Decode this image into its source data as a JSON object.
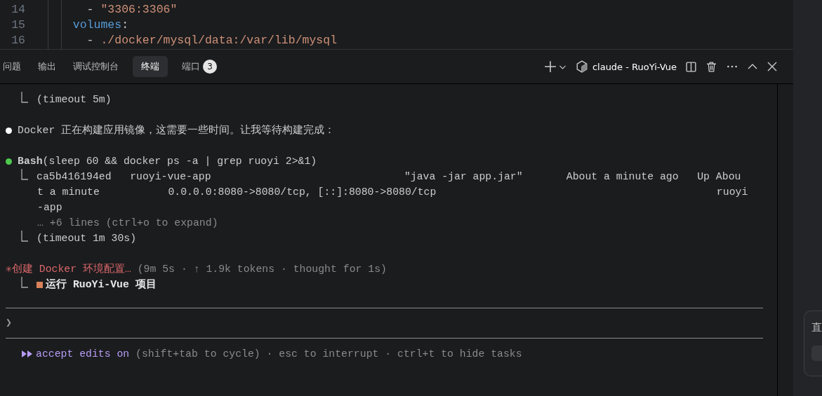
{
  "editor": {
    "lines": [
      {
        "number": "14",
        "segments": [
          {
            "kind": "punct",
            "text": "    - "
          },
          {
            "kind": "string",
            "text": "\"3306:3306\""
          }
        ]
      },
      {
        "number": "15",
        "segments": [
          {
            "kind": "key",
            "text": "  volumes"
          },
          {
            "kind": "punct",
            "text": ":"
          }
        ]
      },
      {
        "number": "16",
        "segments": [
          {
            "kind": "punct",
            "text": "    - "
          },
          {
            "kind": "string",
            "text": "./docker/mysql/data:/var/lib/mysql"
          }
        ]
      }
    ]
  },
  "panel": {
    "tabs": [
      {
        "label": "问题",
        "selected": false
      },
      {
        "label": "输出",
        "selected": false
      },
      {
        "label": "调试控制台",
        "selected": false
      },
      {
        "label": "终端",
        "selected": true
      },
      {
        "label": "端口",
        "selected": false,
        "badge": "3"
      }
    ],
    "terminal_name": "claude - RuoYi-Vue"
  },
  "terminal": {
    "lines": [
      {
        "kind": "result",
        "text": "(timeout 5m)"
      },
      {
        "kind": "blank"
      },
      {
        "kind": "message",
        "color": "#ffffff",
        "text": "Docker 正在构建应用镜像，这需要一些时间。让我等待构建完成："
      },
      {
        "kind": "blank"
      },
      {
        "kind": "message",
        "color": "#4ec94e",
        "text": "**Bash**(sleep 60 && docker ps -a | grep ruoyi 2>&1)"
      },
      {
        "kind": "result",
        "text": "ca5b416194ed   ruoyi-vue-app                               \"java -jar app.jar\"       About a minute ago   Up Abou"
      },
      {
        "kind": "continuation",
        "text": "t a minute           0.0.0.0:8080->8080/tcp, [::]:8080->8080/tcp                                             ruoyi"
      },
      {
        "kind": "continuation",
        "text": "-app"
      },
      {
        "kind": "hint",
        "text": "… +6 lines (ctrl+o to expand)"
      },
      {
        "kind": "result",
        "text": "(timeout 1m 30s)"
      },
      {
        "kind": "blank"
      },
      {
        "kind": "spinner",
        "glyph": "✳",
        "text": "创建 Docker 环境配置…",
        "detail": " (9m 5s · ↑ 1.9k tokens · thought for 1s)"
      },
      {
        "kind": "task",
        "text": "运行 RuoYi-Vue 项目"
      }
    ],
    "prompt": "❯",
    "status": {
      "mode": "accept edits on",
      "hint": " (shift+tab to cycle) · esc to interrupt · ctrl+t to hide tasks"
    }
  },
  "side_card": {
    "text": "直"
  }
}
